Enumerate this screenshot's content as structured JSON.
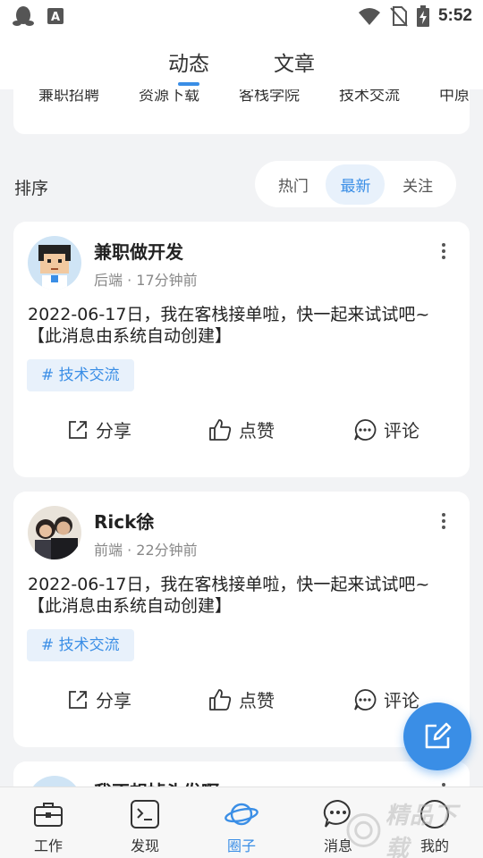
{
  "status_bar": {
    "time": "5:52"
  },
  "top_tabs": [
    {
      "label": "动态",
      "active": true
    },
    {
      "label": "文章",
      "active": false
    }
  ],
  "categories": [
    "兼职招聘",
    "资源下载",
    "客栈学院",
    "技术交流",
    "中原"
  ],
  "sort": {
    "label": "排序",
    "options": [
      {
        "label": "热门",
        "active": false
      },
      {
        "label": "最新",
        "active": true
      },
      {
        "label": "关注",
        "active": false
      }
    ]
  },
  "posts": [
    {
      "name": "兼职做开发",
      "category": "后端",
      "time": "17分钟前",
      "text": "2022-06-17日，我在客栈接单啦，快一起来试试吧~【此消息由系统自动创建】",
      "tag": "# 技术交流",
      "actions": {
        "share": "分享",
        "like": "点赞",
        "comment": "评论"
      }
    },
    {
      "name": "Rick徐",
      "category": "前端",
      "time": "22分钟前",
      "text": "2022-06-17日，我在客栈接单啦，快一起来试试吧~【此消息由系统自动创建】",
      "tag": "# 技术交流",
      "actions": {
        "share": "分享",
        "like": "点赞",
        "comment": "评论"
      }
    },
    {
      "name": "我不想掉头发啊"
    }
  ],
  "bottom_nav": [
    {
      "label": "工作",
      "icon": "briefcase-icon",
      "active": false
    },
    {
      "label": "发现",
      "icon": "terminal-icon",
      "active": false
    },
    {
      "label": "圈子",
      "icon": "planet-icon",
      "active": true
    },
    {
      "label": "消息",
      "icon": "chat-icon",
      "active": false
    },
    {
      "label": "我的",
      "icon": "profile-icon",
      "active": false
    }
  ],
  "watermark": {
    "text": "精品下载"
  },
  "colors": {
    "accent": "#3a8ee6",
    "tag_bg": "#e8f1fb",
    "background": "#f2f3f5"
  }
}
